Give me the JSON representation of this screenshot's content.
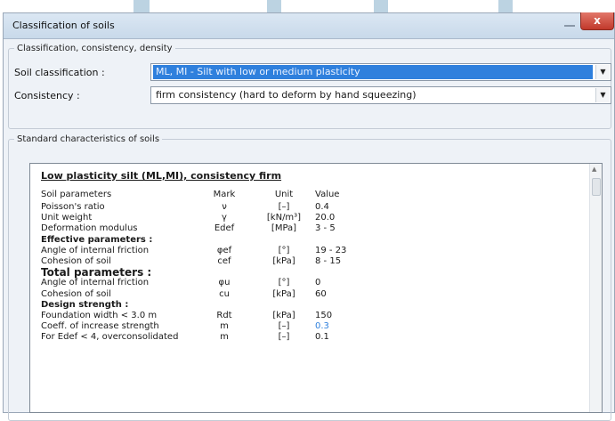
{
  "window": {
    "title": "Classification of soils",
    "close_label": "x"
  },
  "classification_group": {
    "legend": "Classification, consistency, density",
    "soil_label": "Soil classification :",
    "soil_value": "ML, MI - Silt with low or medium plasticity",
    "consistency_label": "Consistency :",
    "consistency_value": "firm consistency (hard to deform by hand squeezing)"
  },
  "standard_group": {
    "legend": "Standard characteristics of soils"
  },
  "panel": {
    "title": "Low plasticity silt (ML,MI), consistency firm",
    "columns": [
      "Soil parameters",
      "Mark",
      "Unit",
      "Value"
    ],
    "rows": [
      {
        "kind": "param",
        "label": "Poisson's ratio",
        "mark": "ν",
        "unit": "[–]",
        "value": "0.4"
      },
      {
        "kind": "param",
        "label": "Unit weight",
        "mark": "γ",
        "unit": "[kN/m³]",
        "value": "20.0"
      },
      {
        "kind": "param",
        "label": "Deformation modulus",
        "mark": "Edef",
        "unit": "[MPa]",
        "value": "3 - 5"
      },
      {
        "kind": "section",
        "label": "Effective parameters :",
        "mark": "",
        "unit": "",
        "value": ""
      },
      {
        "kind": "param",
        "label": "Angle of internal friction",
        "mark": "φef",
        "unit": "[°]",
        "value": "19 - 23"
      },
      {
        "kind": "param",
        "label": "Cohesion of soil",
        "mark": "cef",
        "unit": "[kPa]",
        "value": "8 - 15"
      },
      {
        "kind": "bigsection",
        "label": "Total parameters :",
        "mark": "",
        "unit": "",
        "value": ""
      },
      {
        "kind": "param",
        "label": "Angle of internal friction",
        "mark": "φu",
        "unit": "[°]",
        "value": "0"
      },
      {
        "kind": "param",
        "label": "Cohesion of soil",
        "mark": "cu",
        "unit": "[kPa]",
        "value": "60"
      },
      {
        "kind": "section",
        "label": "Design strength :",
        "mark": "",
        "unit": "",
        "value": ""
      },
      {
        "kind": "param",
        "label": "Foundation width < 3.0 m",
        "mark": "Rdt",
        "unit": "[kPa]",
        "value": "150"
      },
      {
        "kind": "param",
        "label": "Coeff. of increase strength",
        "mark": "m",
        "unit": "[–]",
        "value": "0.3",
        "highlight": true
      },
      {
        "kind": "param",
        "label": "For Edef < 4, overconsolidated",
        "mark": "m",
        "unit": "[–]",
        "value": "0.1"
      }
    ]
  }
}
